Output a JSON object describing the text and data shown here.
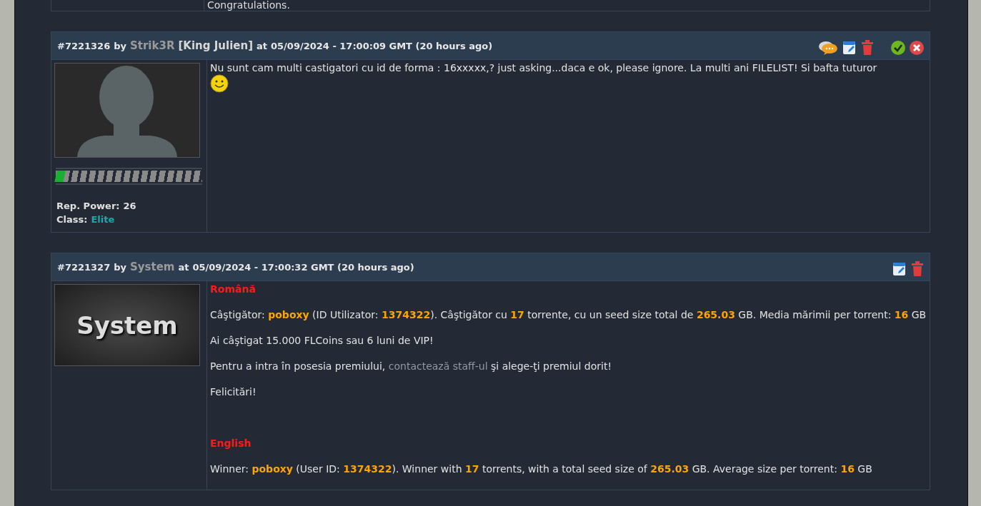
{
  "previous_post": {
    "last_line": "Congratulations."
  },
  "posts": [
    {
      "id": "#7221326",
      "by": "by",
      "author": "Strik3R",
      "title": "[King Julien]",
      "at": "at",
      "date": "05/09/2024 - 17:00:09 GMT (20 hours ago)",
      "actions": [
        {
          "kind": "quote"
        },
        {
          "kind": "edit"
        },
        {
          "kind": "delete"
        },
        {
          "kind": "approve"
        },
        {
          "kind": "reject"
        }
      ],
      "avatar": {
        "kind": "silhouette"
      },
      "reputation": {
        "level": 0.06
      },
      "rep_power_label": "Rep. Power:",
      "rep_power": "26",
      "class_label": "Class:",
      "class": "Elite",
      "body": [
        {
          "kind": "text",
          "text": "Nu sunt cam multi castigatori cu id de forma : 16xxxxx,? just asking...daca e ok, please ignore. La multi ani FILELIST! Si bafta tuturor"
        },
        {
          "kind": "smiley"
        }
      ]
    },
    {
      "id": "#7221327",
      "by": "by",
      "author": "System",
      "at": "at",
      "date": "05/09/2024 - 17:00:32 GMT (20 hours ago)",
      "actions": [
        {
          "kind": "edit"
        },
        {
          "kind": "delete"
        }
      ],
      "avatar": {
        "kind": "logo",
        "text": "System"
      },
      "body": [
        {
          "kind": "heading",
          "text": "Română"
        },
        {
          "kind": "text",
          "text": "Câştigător: **poboxy** (ID Utilizator: **1374322**). Câştigător cu **17** torrente, cu un seed size total de **265.03** GB. Media mărimii per torrent: **16** GB"
        },
        {
          "kind": "text",
          "text": "Ai câştigat 15.000 FLCoins sau 6 luni de VIP!"
        },
        {
          "kind": "link_text",
          "before": "Pentru a intra în posesia premiului,",
          "link": "contactează staff-ul",
          "after": "şi alege-ţi premiul dorit!"
        },
        {
          "kind": "text",
          "text": "Felicitări!"
        },
        {
          "kind": "spacer"
        },
        {
          "kind": "heading",
          "text": "English"
        },
        {
          "kind": "text",
          "text": "Winner: **poboxy** (User ID: **1374322**). Winner with **17** torrents, with a total seed size of **265.03** GB. Average size per torrent: **16** GB"
        }
      ]
    }
  ]
}
